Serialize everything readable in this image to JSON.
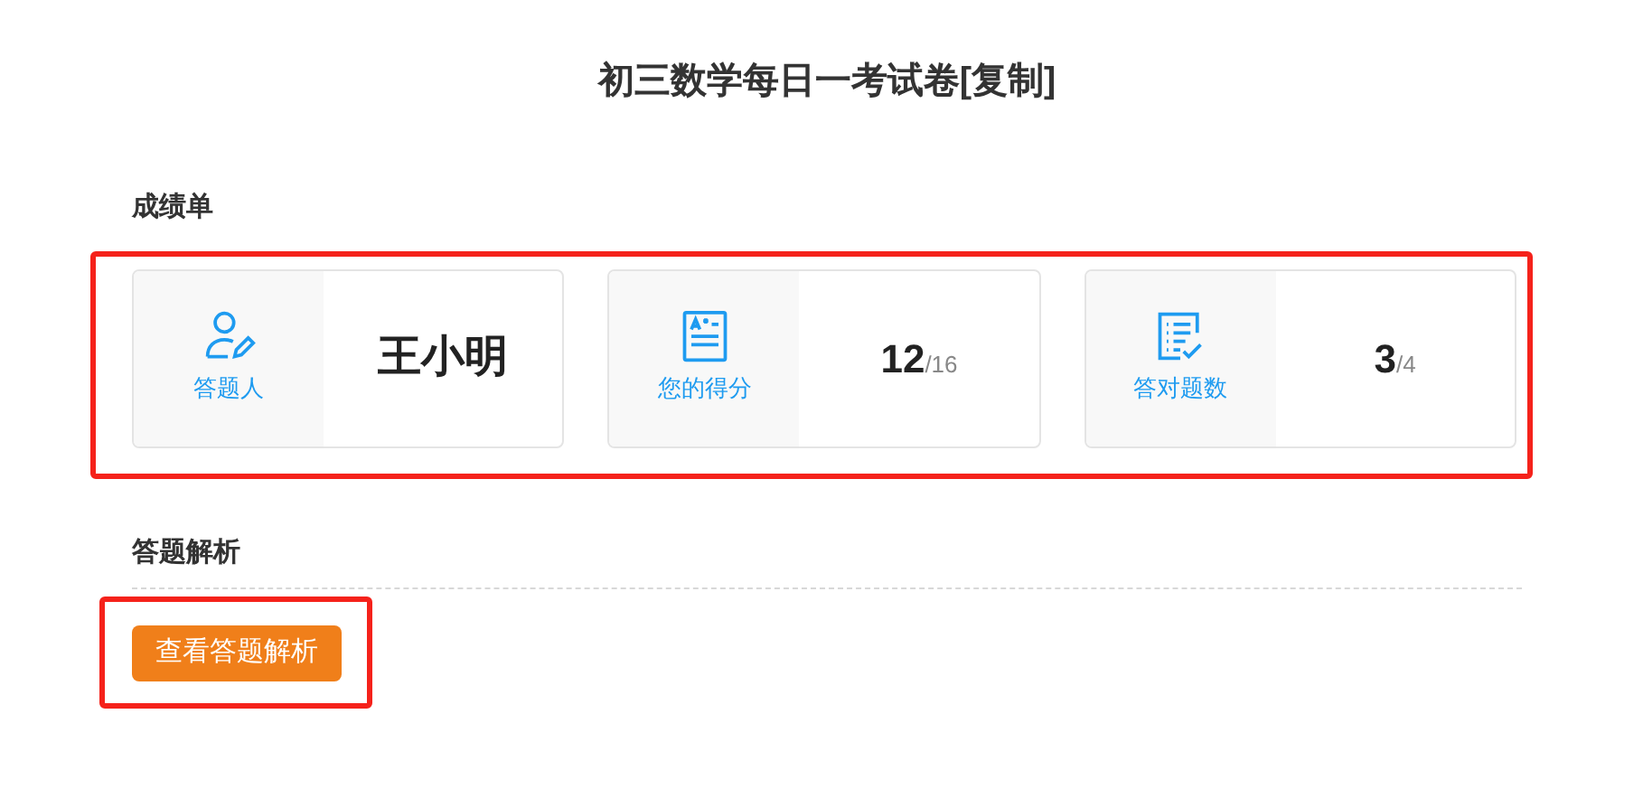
{
  "title": "初三数学每日一考试卷[复制]",
  "score_section": {
    "heading": "成绩单",
    "highlighted": true,
    "cards": [
      {
        "kind": "person",
        "label": "答题人",
        "value": "王小明"
      },
      {
        "kind": "score",
        "label": "您的得分",
        "value": "12",
        "total": "/16"
      },
      {
        "kind": "checklist",
        "label": "答对题数",
        "value": "3",
        "total": "/4"
      }
    ]
  },
  "analysis_section": {
    "heading": "答题解析",
    "button": "查看答题解析",
    "highlighted": true
  }
}
